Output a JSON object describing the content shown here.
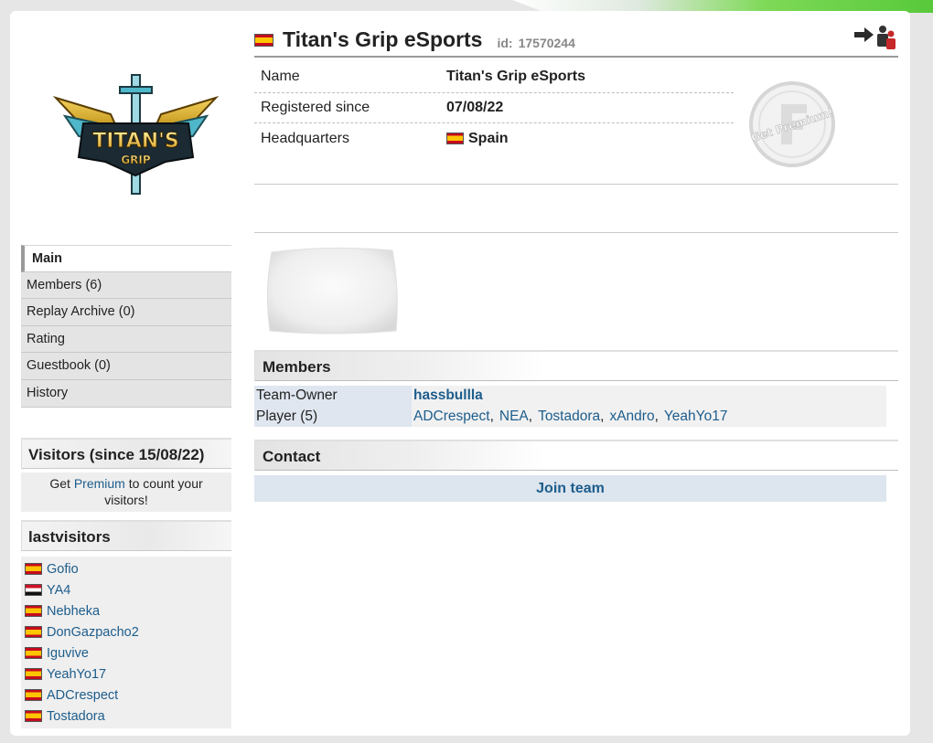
{
  "header": {
    "team_name": "Titan's Grip eSports",
    "id_label": "id:",
    "id_value": "17570244",
    "flag": "flag-spain"
  },
  "logo": {
    "text_top": "TITAN'S",
    "text_bottom": "GRIP"
  },
  "info": {
    "rows": [
      {
        "label": "Name",
        "value": "Titan's Grip eSports"
      },
      {
        "label": "Registered since",
        "value": "07/08/22"
      },
      {
        "label": "Headquarters",
        "value": "Spain",
        "flag": "flag-spain"
      }
    ]
  },
  "premium_badge": {
    "text": "Get Premium!"
  },
  "nav": {
    "items": [
      {
        "label": "Main",
        "active": true
      },
      {
        "label": "Members (6)"
      },
      {
        "label": "Replay Archive (0)"
      },
      {
        "label": "Rating"
      },
      {
        "label": "Guestbook (0)"
      },
      {
        "label": "History"
      }
    ]
  },
  "visitors": {
    "title": "Visitors (since 15/08/22)",
    "text_before": "Get",
    "premium_link": "Premium",
    "text_after": "to count your visitors!"
  },
  "lastvisitors": {
    "title": "lastvisitors",
    "items": [
      {
        "name": "Gofio",
        "flag": "flag-spain"
      },
      {
        "name": "YA4",
        "flag": "flag-egypt"
      },
      {
        "name": "Nebheka",
        "flag": "flag-spain"
      },
      {
        "name": "DonGazpacho2",
        "flag": "flag-spain"
      },
      {
        "name": "Iguvive",
        "flag": "flag-spain"
      },
      {
        "name": "YeahYo17",
        "flag": "flag-spain"
      },
      {
        "name": "ADCrespect",
        "flag": "flag-spain"
      },
      {
        "name": "Tostadora",
        "flag": "flag-spain"
      }
    ]
  },
  "members": {
    "title": "Members",
    "owner_label": "Team-Owner",
    "owner": "hassbullla",
    "player_label": "Player (5)",
    "players": [
      "ADCrespect",
      "NEA",
      "Tostadora",
      "xAndro",
      "YeahYo17"
    ]
  },
  "contact": {
    "title": "Contact",
    "join_label": "Join team"
  },
  "colors": {
    "link": "#1d5d8c",
    "accent_green": "#57c93a"
  }
}
